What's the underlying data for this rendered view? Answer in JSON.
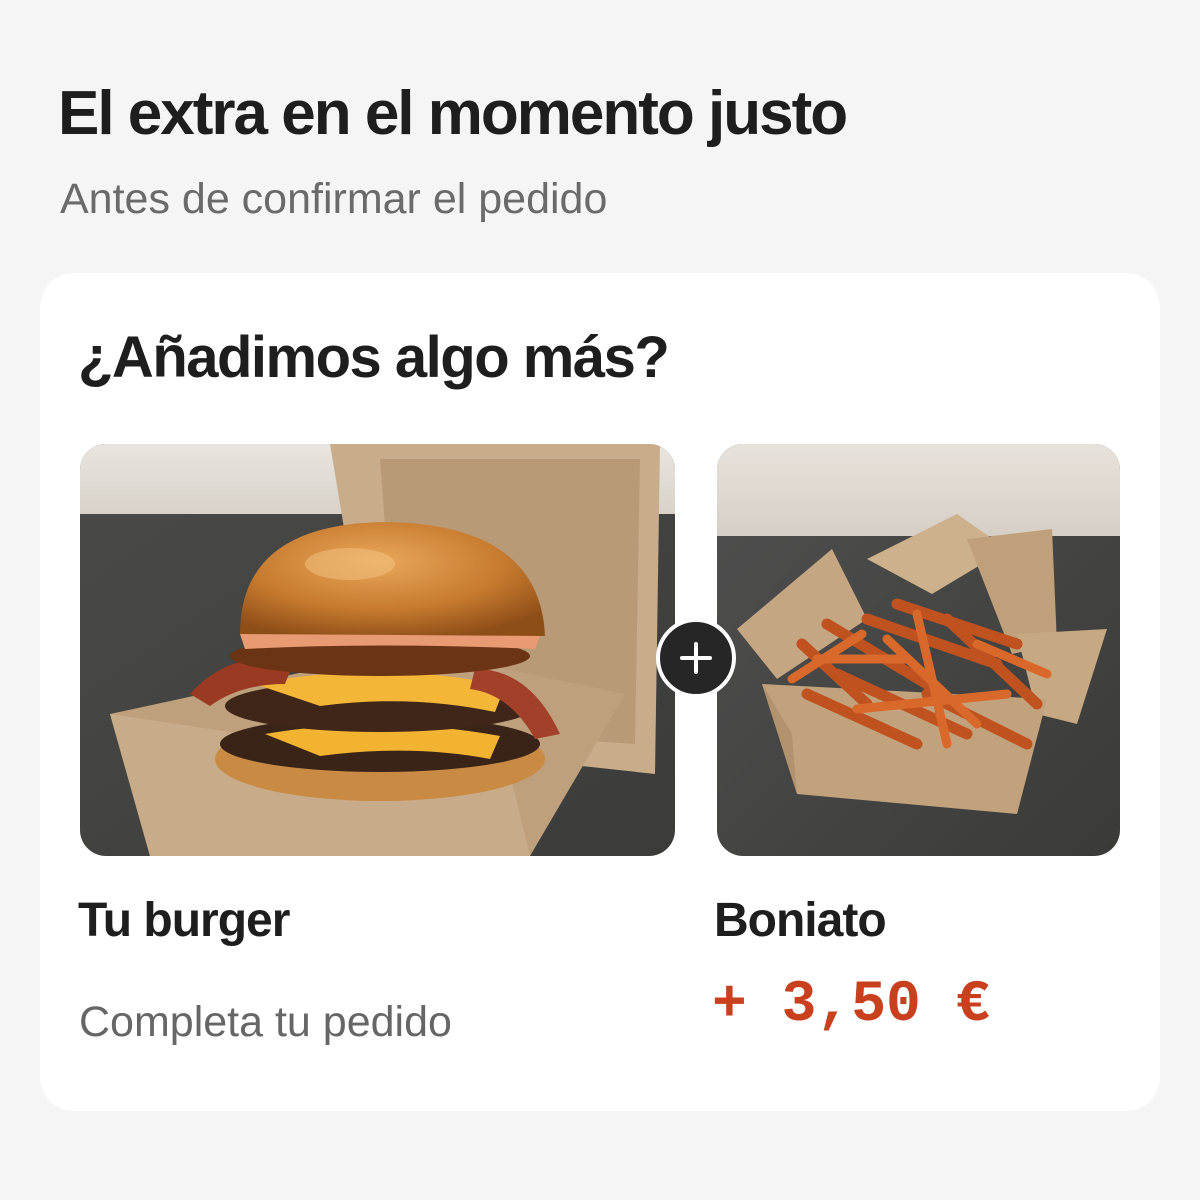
{
  "header": {
    "title": "El extra en el momento justo",
    "subtitle": "Antes de confirmar el pedido"
  },
  "card": {
    "question": "¿Añadimos algo más?",
    "main_item": {
      "name": "Tu burger",
      "description": "Completa tu pedido",
      "image_icon": "burger-photo"
    },
    "add_button_icon": "plus-icon",
    "extra_item": {
      "name": "Boniato",
      "price": "+ 3,50 €",
      "image_icon": "sweet-potato-fries-photo"
    }
  },
  "colors": {
    "background": "#f5f5f5",
    "card": "#ffffff",
    "price_accent": "#c9401e",
    "plus_button": "#262626"
  }
}
